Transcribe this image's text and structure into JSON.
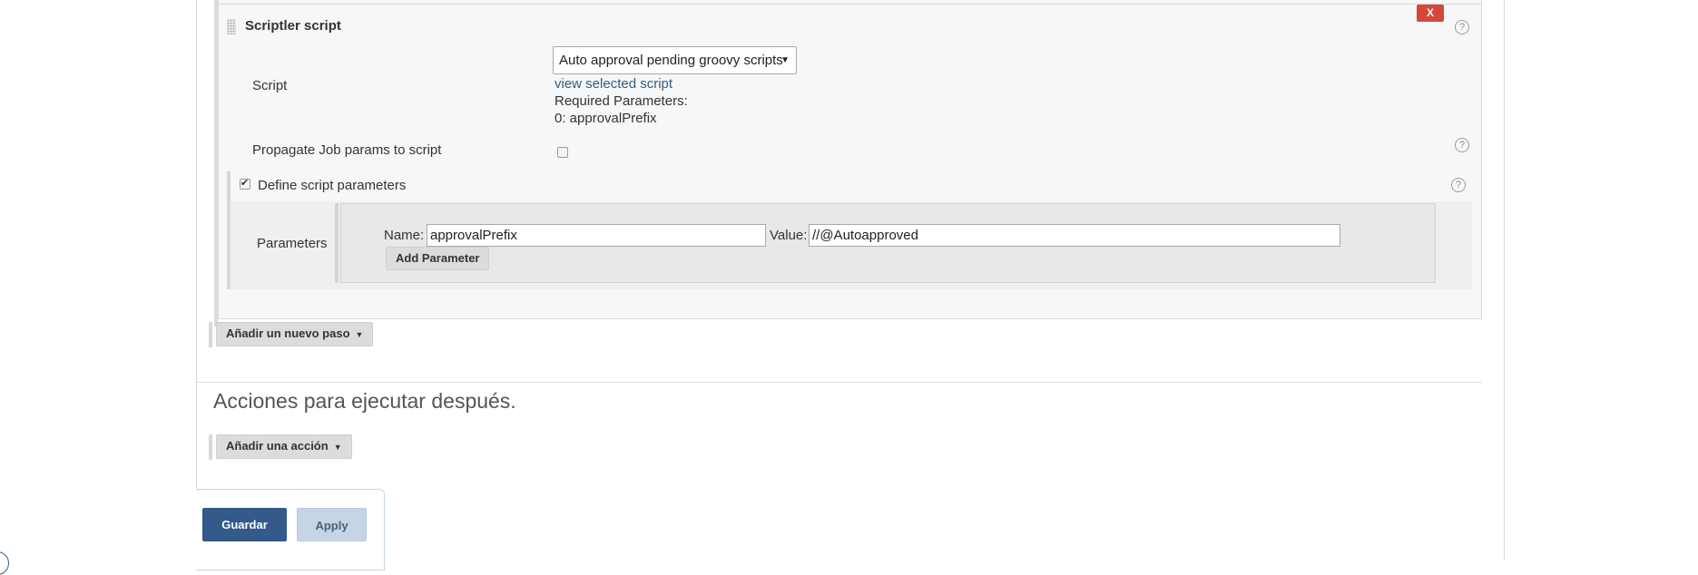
{
  "step": {
    "title": "Scriptler script",
    "delete_label": "X",
    "help_symbol": "?",
    "script_label": "Script",
    "script_select_value": "Auto approval pending groovy scripts",
    "view_script_link": "view selected script",
    "required_params_label": "Required Parameters:",
    "required_param_0": "0: approvalPrefix",
    "propagate_label": "Propagate Job params to script",
    "propagate_checked": false,
    "define_params_label": "Define script parameters",
    "define_params_checked": true,
    "parameters_label": "Parameters",
    "param_name_label": "Name:",
    "param_name_value": "approvalPrefix",
    "param_value_label": "Value:",
    "param_value_value": "//@Autoapproved",
    "add_parameter_label": "Add Parameter"
  },
  "add_step_button": "Añadir un nuevo paso",
  "post_actions": {
    "title": "Acciones para ejecutar después.",
    "add_action_button": "Añadir una acción"
  },
  "footer": {
    "save_label": "Guardar",
    "apply_label": "Apply"
  },
  "icons": {
    "dropdown": "caret-down-icon",
    "help": "question-circle-icon",
    "drag": "drag-handle-icon"
  },
  "colors": {
    "primary": "#335a8a",
    "danger": "#d24939",
    "link": "#2f5d86"
  }
}
